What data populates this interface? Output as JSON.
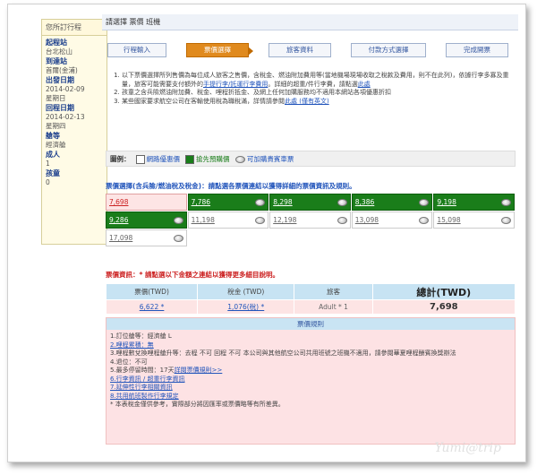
{
  "sidebar": {
    "header": "您所訂行程",
    "items": [
      {
        "label": "起程站",
        "value": "台北松山"
      },
      {
        "label": "到達站",
        "value": "首爾(金浦)"
      },
      {
        "label": "出發日期",
        "value": "2014-02-09",
        "value2": "星期日"
      },
      {
        "label": "回程日期",
        "value": "2014-02-13",
        "value2": "星期四"
      },
      {
        "label": "艙等",
        "value": "經濟艙"
      },
      {
        "label": "成人",
        "value": "1"
      },
      {
        "label": "孩童",
        "value": "0"
      }
    ]
  },
  "main": {
    "title": "請選擇 票價 班機",
    "steps": [
      "行程輸入",
      "票價選擇",
      "旅客資料",
      "付款方式選擇",
      "完成開票"
    ],
    "notes": [
      "以下票價選擇所列售價為每位成人旅客之售價，含稅金、燃油附加費用等(當地機場現場收取之稅款及費用，則不在此列)，依據行李多寡及重量，旅客可能需要支付額外的",
      "手提行李/託運行李費用",
      "。詳細的超重/件行李費，請點選",
      "此處",
      "孩童之含兵險燃油附加費、稅金、哩程折抵金、及網上任何加購服務均不適用本網站各項優惠折扣",
      "某些國家要求航空公司在客輸使用稅為職稅滿，詳情請參閱",
      "此處 (僅有英文)"
    ],
    "legend": {
      "label": "圖例：",
      "item1": "網路優惠價",
      "item2": "搶先預購價",
      "item3": "可加購貴賓車票"
    },
    "fares_title": "票價選擇(含兵險/燃油稅及稅金)：請點選各票價連結以獲得詳細的票價資訊及規則。",
    "fares_row1": [
      "7,698",
      "7,786",
      "8,298",
      "8,386",
      "9,198"
    ],
    "fares_row2": [
      "9,286",
      "11,198",
      "12,198",
      "13,098",
      "15,098"
    ],
    "fares_row3": [
      "17,098"
    ],
    "fare_info_title": "票價資訊：* 請點選以下金額之連結以獲得更多細目說明。",
    "table": {
      "headers": [
        "票價(TWD)",
        "稅金 (TWD)",
        "旅客",
        "總計(TWD)"
      ],
      "row": [
        "6,622 *",
        "1,076(稅) *",
        "Adult * 1",
        "7,698"
      ]
    },
    "rules_title": "票價規則",
    "rules": [
      "1.訂位艙等：經濟艙 L",
      "2.哩程累積：無",
      "3.哩程數兌換哩程艙升等：去程 不可  回程 不可  本公司與其他航空公司共用班號之班機不適用，請參閱華夏哩程酬賓換獎辦法",
      "4.退位：不可",
      "5.最多停留時間：17天",
      "詳閱票價規則>>",
      "6.行李資訊 / 超重行李資訊",
      "7.延伸性行李相關資訊",
      "8.共用航班製作行李規定",
      "* 本表稅金僅供參考，實際部分將因匯率或票價略等有所差異。"
    ]
  },
  "watermark": "Yumi@trip"
}
